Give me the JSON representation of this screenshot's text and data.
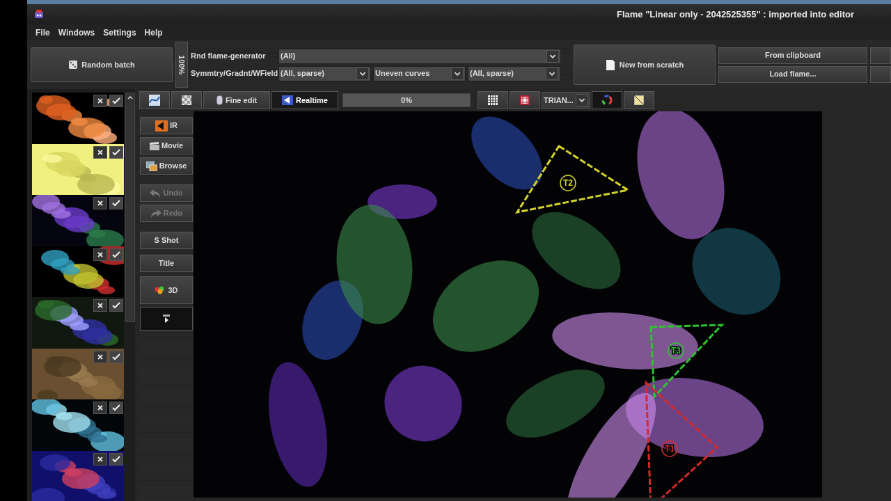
{
  "window": {
    "title": "Flame \"Linear only - 2042525355\" : imported into editor"
  },
  "menu": [
    "File",
    "Windows",
    "Settings",
    "Help"
  ],
  "top_toolbar": {
    "random_batch": "Random batch",
    "zoom_label": "100%",
    "generator_label": "Rnd flame-generator",
    "generator_value": "(All)",
    "symmetry_label": "Symmtry/Gradnt/WField",
    "symmetry_value": "(All, sparse)",
    "gradient_value": "Uneven curves",
    "weightfield_value": "(All, sparse)",
    "new_from_scratch": "New from scratch",
    "from_clipboard": "From clipboard",
    "load_flame": "Load flame..."
  },
  "editor_toolbar": {
    "fine_edit": {
      "label": "Fine edit",
      "selected": false
    },
    "realtime": {
      "label": "Realtime",
      "selected": true
    },
    "progress": {
      "level": 0,
      "reading": "0%"
    },
    "mode_value": "TRIAN..."
  },
  "side_buttons": [
    {
      "label": "IR",
      "disabled": false
    },
    {
      "label": "Movie",
      "disabled": false
    },
    {
      "label": "Browse",
      "disabled": false
    },
    {
      "label": "Undo",
      "disabled": true
    },
    {
      "label": "Redo",
      "disabled": true
    },
    {
      "label": "S Shot",
      "disabled": false
    },
    {
      "label": "Title",
      "disabled": false
    },
    {
      "label": "3D",
      "disabled": false
    }
  ],
  "triangles": [
    {
      "label": "T2",
      "color": "#d4d42a"
    },
    {
      "label": "T3",
      "color": "#2ec42e"
    },
    {
      "label": "T1",
      "color": "#d42a2a"
    }
  ]
}
